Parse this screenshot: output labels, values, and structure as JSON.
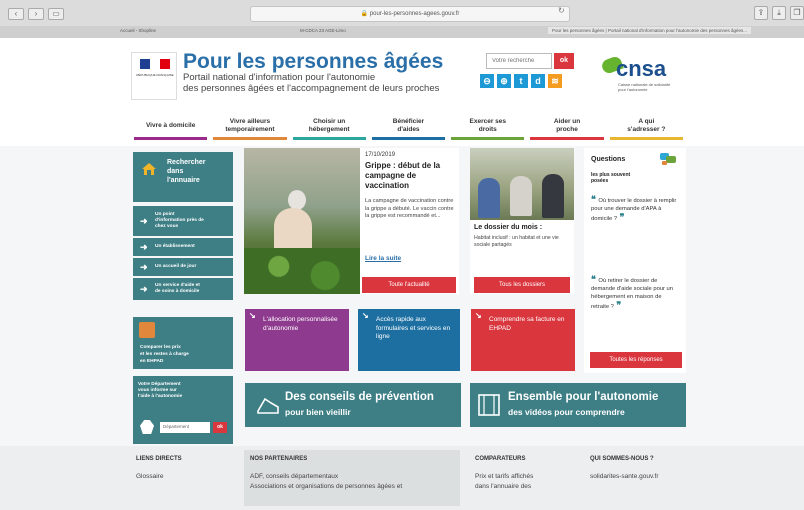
{
  "browser": {
    "url": "pour-les-personnes-agees.gouv.fr",
    "tab_left_1": "Accueil - Shopline",
    "tab_left_2": "M-CDCA 23 AGE-Limo",
    "tab_active": "Pour les personnes âgées | Portail national d'information pour l'autonomie des personnes âgées..."
  },
  "header": {
    "marianne_text": "RÉPUBLIQUE FRANÇAISE",
    "title": "Pour les personnes âgées",
    "subtitle_line1": "Portail national d'information pour l'autonomie",
    "subtitle_line2": "des personnes âgées et l'accompagnement de leurs proches",
    "search_placeholder": "Votre recherche",
    "search_button": "ok",
    "cnsa_word": "cnsa",
    "cnsa_tagline": "Caisse nationale de solidarité pour l'autonomie"
  },
  "nav": [
    {
      "label_l1": "Vivre à domicile",
      "label_l2": "",
      "color": "#9c2a8a"
    },
    {
      "label_l1": "Vivre ailleurs",
      "label_l2": "temporairement",
      "color": "#e0873b"
    },
    {
      "label_l1": "Choisir un",
      "label_l2": "hébergement",
      "color": "#2ea6a0"
    },
    {
      "label_l1": "Bénéficier",
      "label_l2": "d'aides",
      "color": "#1d6fa2"
    },
    {
      "label_l1": "Exercer ses",
      "label_l2": "droits",
      "color": "#6ca33a"
    },
    {
      "label_l1": "Aider un",
      "label_l2": "proche",
      "color": "#d9363e"
    },
    {
      "label_l1": "A qui",
      "label_l2": "s'adresser ?",
      "color": "#e8b731"
    }
  ],
  "annuaire": {
    "title_l1": "Rechercher",
    "title_l2": "dans",
    "title_l3": "l'annuaire",
    "links": [
      {
        "l1": "Un point",
        "l2": "d'information près de",
        "l3": "chez vous"
      },
      {
        "l1": "Un établissement",
        "l2": "",
        "l3": ""
      },
      {
        "l1": "Un accueil de jour",
        "l2": "",
        "l3": ""
      },
      {
        "l1": "Un service d'aide et",
        "l2": "de soins à domicile",
        "l3": ""
      }
    ]
  },
  "comparer": {
    "l1": "Comparer les prix",
    "l2": "et les restes à charge",
    "l3": "en EHPAD"
  },
  "departement": {
    "l1": "Votre Département",
    "l2": "vous informe sur",
    "l3": "l'aide à l'autonomie",
    "select_placeholder": "Département",
    "ok": "ok"
  },
  "news": {
    "date": "17/10/2019",
    "title": "Grippe : début de la campagne de vaccination",
    "body": "La campagne de vaccination contre la grippe a débuté. Le vaccin contre la grippe est recommandé et...",
    "more": "Lire la suite",
    "button": "Toute l'actualité"
  },
  "dossier": {
    "title": "Le dossier du mois :",
    "body": "Habitat inclusif : un habitat et une vie sociale partagés",
    "button": "Tous les dossiers"
  },
  "questions": {
    "title_l1": "Questions",
    "sub_l1": "les plus souvent",
    "sub_l2": "posées",
    "q1": "Où trouver le dossier à remplir pour une demande d'APA à domicile ?",
    "q2": "Où retirer le dossier de demande d'aide sociale pour un hébergement en maison de retraite ?",
    "button": "Toutes les réponses"
  },
  "tiles": {
    "apa": "L'allocation personnalisée d'autonomie",
    "forms": "Accès rapide aux formulaires et services en ligne",
    "ehpad": "Comprendre sa facture en EHPAD"
  },
  "banners": {
    "prev_l1": "Des conseils de prévention",
    "prev_l2": "pour bien vieillir",
    "vid_l1": "Ensemble pour l'autonomie",
    "vid_l2": "des vidéos pour comprendre"
  },
  "footer": {
    "liens_title": "LIENS DIRECTS",
    "liens_1": "Glossaire",
    "partners_title": "NOS PARTENAIRES",
    "partners_1": "ADF, conseils départementaux",
    "partners_2": "Associations et organisations de personnes âgées et",
    "comparateurs_title": "COMPARATEURS",
    "comparateurs_1": "Prix et tarifs affichés",
    "comparateurs_2": "dans l'annuaire des",
    "qui_title": "QUI SOMMES-NOUS ?",
    "qui_1": "solidarites-sante.gouv.fr"
  }
}
